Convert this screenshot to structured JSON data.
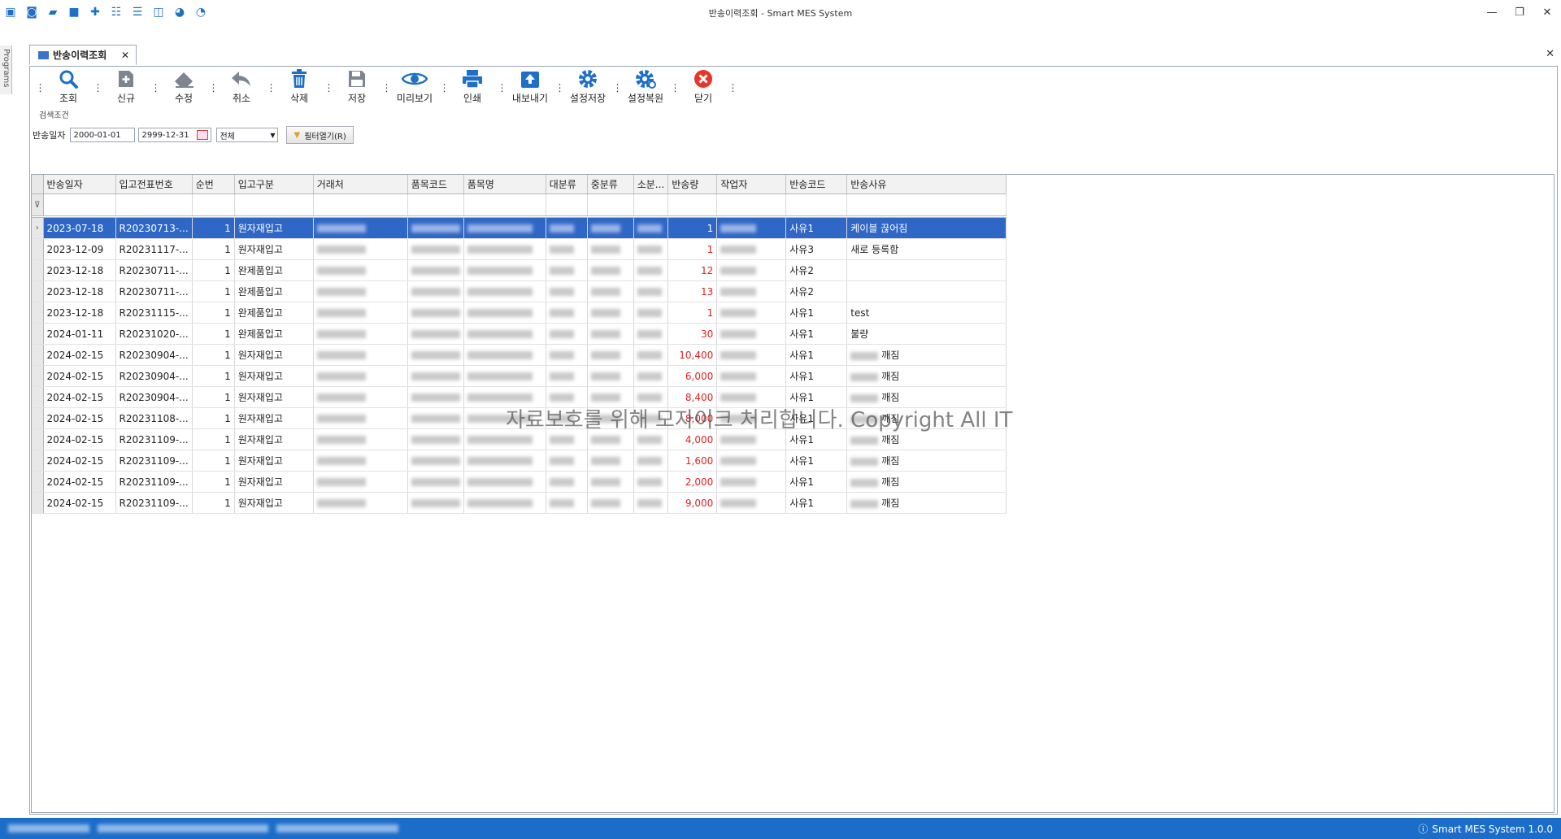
{
  "window": {
    "title": "반송이력조회 - Smart MES System"
  },
  "sidebar": {
    "label": "Programs"
  },
  "tab": {
    "label": "반송이력조회",
    "close": "✕"
  },
  "toolbar": {
    "search": "조회",
    "new": "신규",
    "edit": "수정",
    "cancel": "취소",
    "delete": "삭제",
    "save": "저장",
    "preview": "미리보기",
    "print": "인쇄",
    "export": "내보내기",
    "save_settings": "설정저장",
    "restore_settings": "설정복원",
    "close": "닫기"
  },
  "search": {
    "group_label": "검색조건",
    "date_label": "반송일자",
    "date_from": "2000-01-01",
    "date_to": "2999-12-31",
    "type_value": "전체",
    "filter_button": "필터열기(R)"
  },
  "grid": {
    "columns": [
      "반송일자",
      "입고전표번호",
      "순번",
      "입고구분",
      "거래처",
      "품목코드",
      "품목명",
      "대분류",
      "중분류",
      "소분...",
      "반송량",
      "작업자",
      "반송코드",
      "반송사유"
    ],
    "rows": [
      {
        "date": "2023-07-18",
        "doc": "R20230713-...",
        "seq": "1",
        "type": "원자재입고",
        "qty": "1",
        "code": "사유1",
        "reason": "케이블 끊어짐"
      },
      {
        "date": "2023-12-09",
        "doc": "R20231117-...",
        "seq": "1",
        "type": "원자재입고",
        "qty": "1",
        "code": "사유3",
        "reason": "새로 등록함"
      },
      {
        "date": "2023-12-18",
        "doc": "R20230711-...",
        "seq": "1",
        "type": "완제품입고",
        "qty": "12",
        "code": "사유2",
        "reason": ""
      },
      {
        "date": "2023-12-18",
        "doc": "R20230711-...",
        "seq": "1",
        "type": "완제품입고",
        "qty": "13",
        "code": "사유2",
        "reason": ""
      },
      {
        "date": "2023-12-18",
        "doc": "R20231115-...",
        "seq": "1",
        "type": "완제품입고",
        "qty": "1",
        "code": "사유1",
        "reason": "test"
      },
      {
        "date": "2024-01-11",
        "doc": "R20231020-...",
        "seq": "1",
        "type": "완제품입고",
        "qty": "30",
        "code": "사유1",
        "reason": "불량"
      },
      {
        "date": "2024-02-15",
        "doc": "R20230904-...",
        "seq": "1",
        "type": "원자재입고",
        "qty": "10,400",
        "code": "사유1",
        "reason": "깨짐"
      },
      {
        "date": "2024-02-15",
        "doc": "R20230904-...",
        "seq": "1",
        "type": "원자재입고",
        "qty": "6,000",
        "code": "사유1",
        "reason": "깨짐"
      },
      {
        "date": "2024-02-15",
        "doc": "R20230904-...",
        "seq": "1",
        "type": "원자재입고",
        "qty": "8,400",
        "code": "사유1",
        "reason": "깨짐"
      },
      {
        "date": "2024-02-15",
        "doc": "R20231108-...",
        "seq": "1",
        "type": "원자재입고",
        "qty": "8,000",
        "code": "사유1",
        "reason": "깨짐"
      },
      {
        "date": "2024-02-15",
        "doc": "R20231109-...",
        "seq": "1",
        "type": "원자재입고",
        "qty": "4,000",
        "code": "사유1",
        "reason": "깨짐"
      },
      {
        "date": "2024-02-15",
        "doc": "R20231109-...",
        "seq": "1",
        "type": "원자재입고",
        "qty": "1,600",
        "code": "사유1",
        "reason": "깨짐"
      },
      {
        "date": "2024-02-15",
        "doc": "R20231109-...",
        "seq": "1",
        "type": "원자재입고",
        "qty": "2,000",
        "code": "사유1",
        "reason": "깨짐"
      },
      {
        "date": "2024-02-15",
        "doc": "R20231109-...",
        "seq": "1",
        "type": "원자재입고",
        "qty": "9,000",
        "code": "사유1",
        "reason": "깨짐"
      }
    ]
  },
  "watermark": "자료보호를 위해 모자이크 처리합니다. Copyright All IT",
  "status": {
    "version": "Smart MES System 1.0.0"
  },
  "colors": {
    "accent": "#1c6dc9",
    "selection": "#2f67c7",
    "qty": "#e02020"
  }
}
